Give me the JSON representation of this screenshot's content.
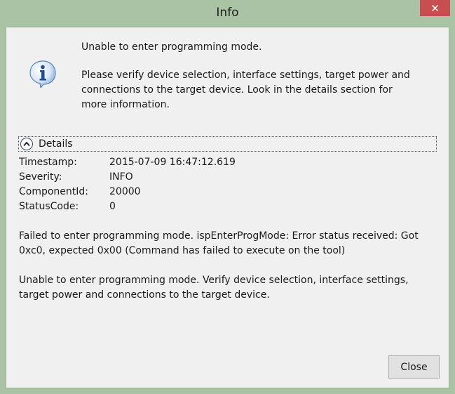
{
  "window": {
    "title": "Info",
    "close_glyph": "✕"
  },
  "message": {
    "main": "Unable to enter programming mode.",
    "detail": "Please verify device selection, interface settings, target power and connections to the target device. Look in the details section for more information."
  },
  "details": {
    "label": "Details",
    "expanded": true,
    "fields": [
      {
        "key": "Timestamp:",
        "value": "2015-07-09 16:47:12.619"
      },
      {
        "key": "Severity:",
        "value": "INFO"
      },
      {
        "key": "ComponentId:",
        "value": "20000"
      },
      {
        "key": "StatusCode:",
        "value": "0"
      }
    ],
    "paragraph1": "Failed to enter programming mode. ispEnterProgMode: Error status received: Got 0xc0, expected 0x00 (Command has failed to execute on the tool)",
    "paragraph2": "Unable to enter programming mode. Verify device selection, interface settings, target power and connections to the target device."
  },
  "buttons": {
    "close_label": "Close"
  },
  "icons": {
    "info": "info-icon",
    "chevron": "chevron-up-icon",
    "close": "close-icon"
  },
  "colors": {
    "window_frame": "#a9c3a4",
    "close_button": "#c74f50",
    "client_bg": "#f0f0f0"
  }
}
